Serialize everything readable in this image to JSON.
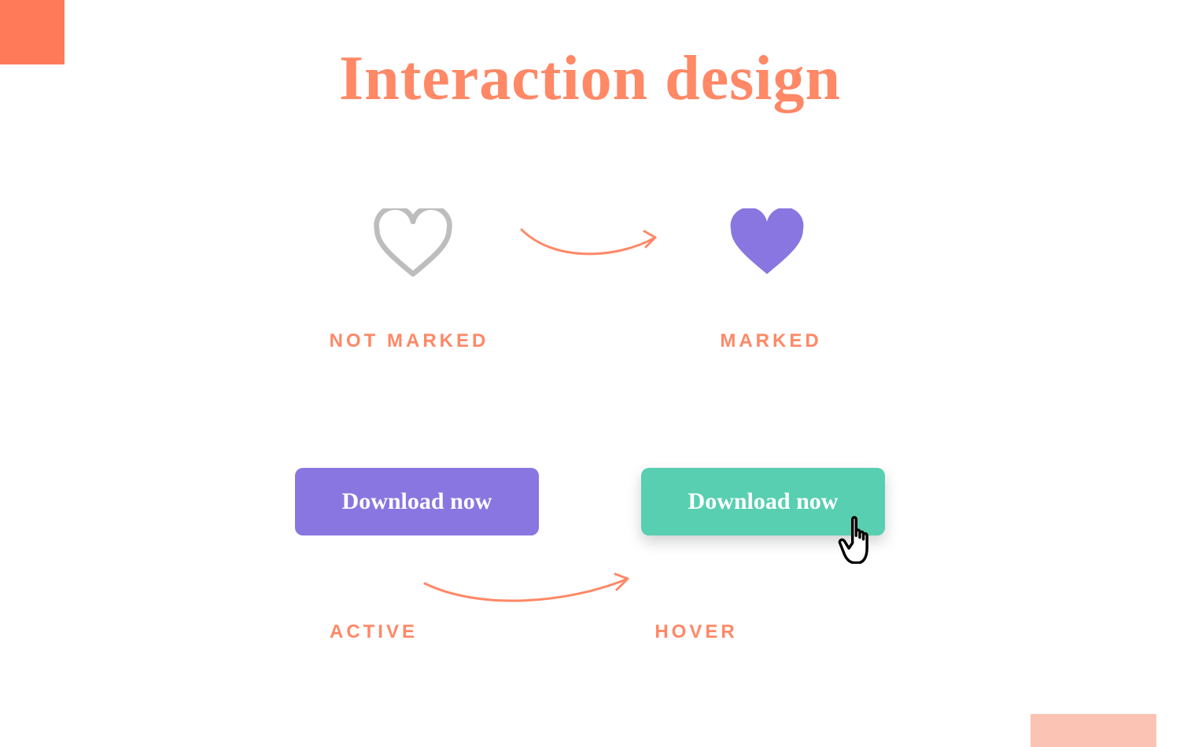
{
  "title": "Interaction design",
  "hearts": {
    "not_marked_label": "NOT MARKED",
    "marked_label": "MARKED"
  },
  "buttons": {
    "active_label": "ACTIVE",
    "hover_label": "HOVER",
    "download_text": "Download now"
  },
  "colors": {
    "accent": "#FF8866",
    "purple": "#8976E0",
    "teal": "#58CFB1",
    "grey": "#BDBDBD",
    "peach_light": "#FBC3B3",
    "peach_solid": "#FF7A59"
  }
}
